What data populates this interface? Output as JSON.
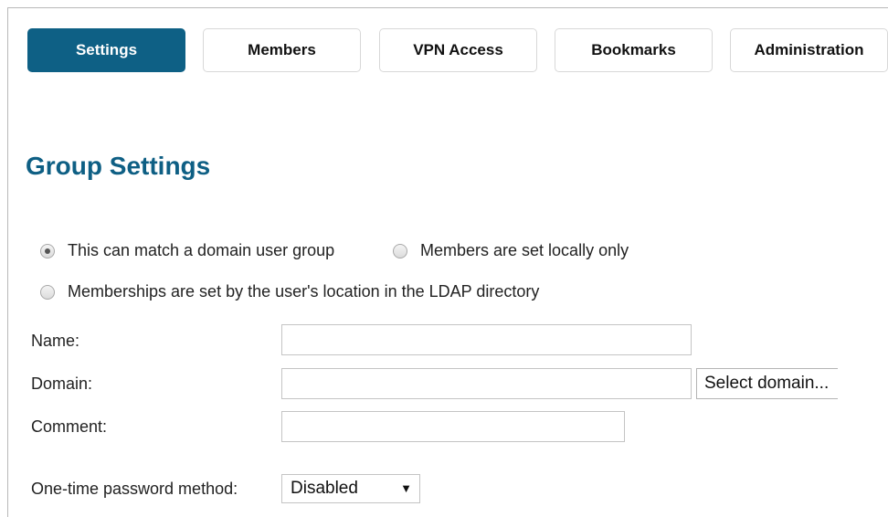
{
  "tabs": [
    {
      "label": "Settings",
      "active": true
    },
    {
      "label": "Members",
      "active": false
    },
    {
      "label": "VPN Access",
      "active": false
    },
    {
      "label": "Bookmarks",
      "active": false
    },
    {
      "label": "Administration",
      "active": false
    }
  ],
  "page_title": "Group Settings",
  "membership_options": [
    {
      "label": "This can match a domain user group",
      "checked": true
    },
    {
      "label": "Members are set locally only",
      "checked": false
    },
    {
      "label": "Memberships are set by the user's location in the LDAP directory",
      "checked": false
    }
  ],
  "form": {
    "name_label": "Name:",
    "name_value": "",
    "domain_label": "Domain:",
    "domain_value": "",
    "select_domain_button": "Select domain...",
    "comment_label": "Comment:",
    "comment_value": "",
    "otp_label": "One-time password method:",
    "otp_selected": "Disabled"
  },
  "colors": {
    "accent": "#0e6085",
    "title": "#0e5f84"
  },
  "icons": {
    "select_caret": "triangle-down-icon"
  }
}
